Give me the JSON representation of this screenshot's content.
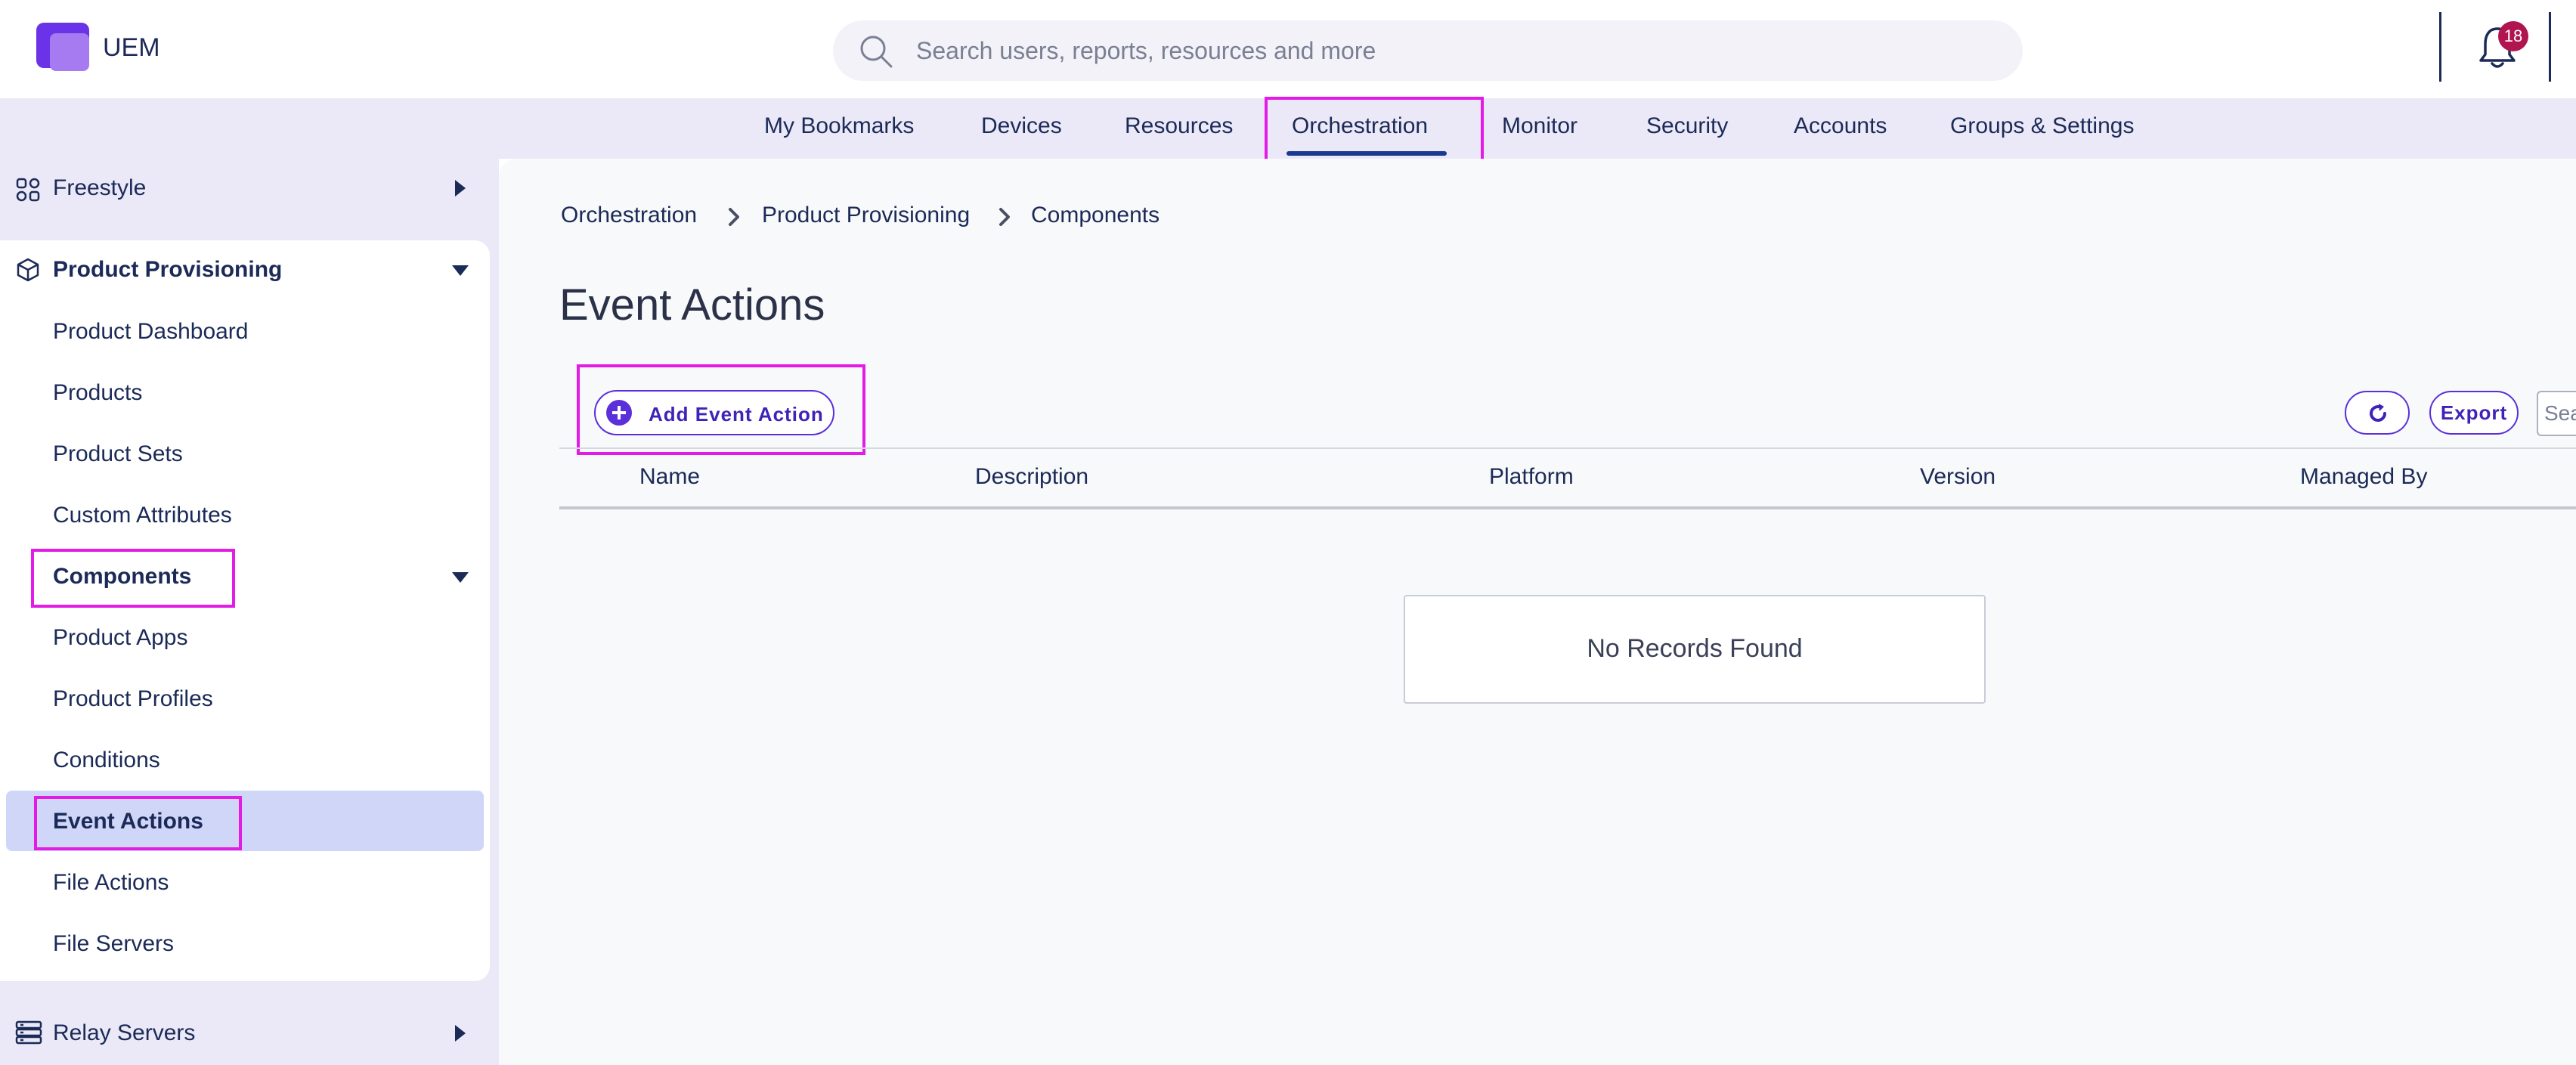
{
  "app": {
    "name": "UEM"
  },
  "search": {
    "placeholder": "Search users, reports, resources and more"
  },
  "notifications": {
    "count": "18"
  },
  "nav": {
    "tabs": [
      "My Bookmarks",
      "Devices",
      "Resources",
      "Orchestration",
      "Monitor",
      "Security",
      "Accounts",
      "Groups & Settings"
    ],
    "active": "Orchestration"
  },
  "sidebar": {
    "freestyle": "Freestyle",
    "product_provisioning": "Product Provisioning",
    "items": [
      "Product Dashboard",
      "Products",
      "Product Sets",
      "Custom Attributes"
    ],
    "components": "Components",
    "component_items": [
      "Product Apps",
      "Product Profiles",
      "Conditions",
      "Event Actions",
      "File Actions",
      "File Servers"
    ],
    "relay_servers": "Relay Servers",
    "selected": "Event Actions"
  },
  "breadcrumb": [
    "Orchestration",
    "Product Provisioning",
    "Components"
  ],
  "page": {
    "title": "Event Actions"
  },
  "toolbar": {
    "add_label": "Add Event Action",
    "export_label": "Export",
    "search_placeholder": "Search"
  },
  "table": {
    "columns": [
      "Name",
      "Description",
      "Platform",
      "Version",
      "Managed By"
    ],
    "empty_message": "No Records Found"
  },
  "colors": {
    "accent": "#5b2fd9",
    "highlight": "#e21be6",
    "selected_bg": "#cfd6f8",
    "badge": "#b0154f"
  }
}
